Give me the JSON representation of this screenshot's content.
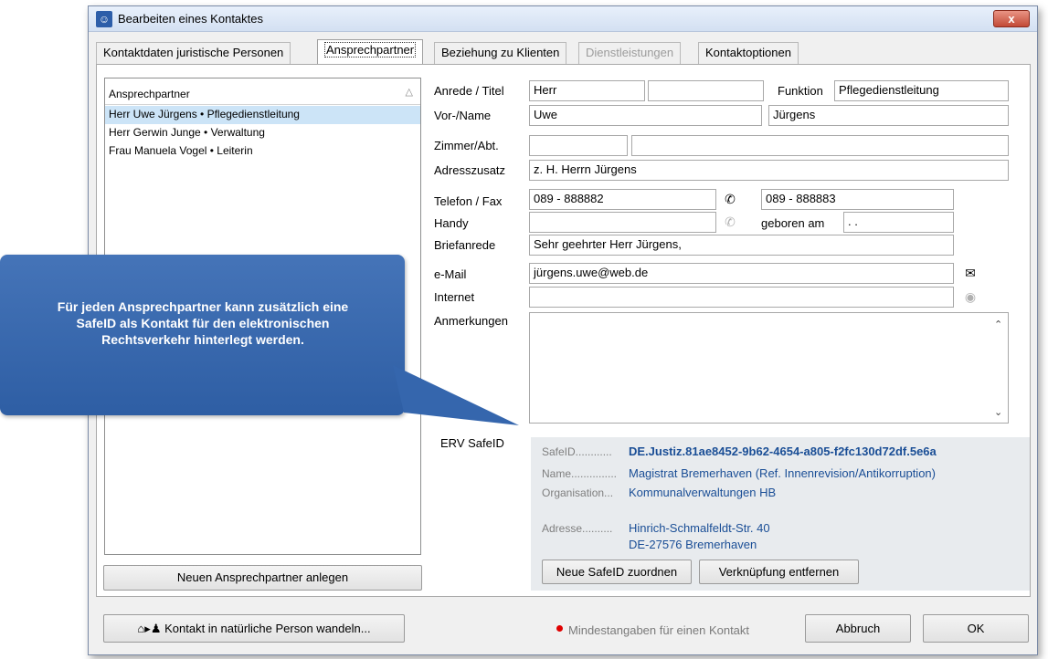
{
  "window": {
    "title": "Bearbeiten eines Kontaktes",
    "close_label": "x"
  },
  "tabs": [
    {
      "label": "Kontaktdaten juristische Personen"
    },
    {
      "label": "Ansprechpartner"
    },
    {
      "label": "Beziehung zu Klienten"
    },
    {
      "label": "Dienstleistungen"
    },
    {
      "label": "Kontaktoptionen"
    }
  ],
  "contacts_list": {
    "header": "Ansprechpartner",
    "items": [
      {
        "label": "Herr Uwe Jürgens  • Pflegedienstleitung"
      },
      {
        "label": "Herr Gerwin Junge  • Verwaltung"
      },
      {
        "label": "Frau Manuela Vogel  • Leiterin"
      }
    ],
    "new_button": "Neuen Ansprechpartner anlegen"
  },
  "form": {
    "labels": {
      "title": "Anrede / Titel",
      "name": "Vor-/Name",
      "room": "Zimmer/Abt.",
      "address_extra": "Adresszusatz",
      "phone_fax": "Telefon / Fax",
      "mobile": "Handy",
      "salutation": "Briefanrede",
      "email": "e-Mail",
      "internet": "Internet",
      "notes": "Anmerkungen",
      "function": "Funktion",
      "birthday": "geboren am",
      "erv": "ERV SafeID"
    },
    "values": {
      "anrede": "Herr",
      "titel": "",
      "funktion": "Pflegedienstleitung",
      "vorname": "Uwe",
      "nachname": "Jürgens",
      "zimmer": "",
      "abt": "",
      "adresszusatz": "z. H. Herrn Jürgens",
      "telefon": "089 - 888882",
      "fax": "089 - 888883",
      "handy": "",
      "geboren": " .  .",
      "briefanrede": "Sehr geehrter Herr Jürgens,",
      "email": "jürgens.uwe@web.de",
      "internet": "",
      "anmerkungen": ""
    }
  },
  "erv": {
    "safeid_label": "SafeID............",
    "safeid": "DE.Justiz.81ae8452-9b62-4654-a805-f2fc130d72df.5e6a",
    "name_label": "Name...............",
    "name": "Magistrat Bremerhaven (Ref. Innenrevision/Antikorruption)",
    "org_label": "Organisation...",
    "org": "Kommunalverwaltungen HB",
    "address_label": "Adresse..........",
    "address_line1": "Hinrich-Schmalfeldt-Str. 40",
    "address_line2": "DE-27576 Bremerhaven",
    "assign_button": "Neue SafeID zuordnen",
    "unlink_button": "Verknüpfung entfernen"
  },
  "footer": {
    "convert_button": "Kontakt in natürliche Person wandeln...",
    "required_note": "Mindestangaben für einen Kontakt",
    "cancel_button": "Abbruch",
    "ok_button": "OK"
  },
  "callout": {
    "text": "Für jeden Ansprechpartner kann zusätzlich eine SafeID als Kontakt für den elektronischen Rechtsverkehr hinterlegt werden."
  },
  "colors": {
    "selection": "#cce4f7",
    "callout": "#3a68ae",
    "link_blue": "#1a4e96",
    "required_dot": "#e00000"
  },
  "icons": [
    "contact-card-icon",
    "phone-icon",
    "envelope-icon",
    "globe-icon",
    "home-icon",
    "person-icon",
    "scroll-up-icon",
    "scroll-down-icon"
  ]
}
